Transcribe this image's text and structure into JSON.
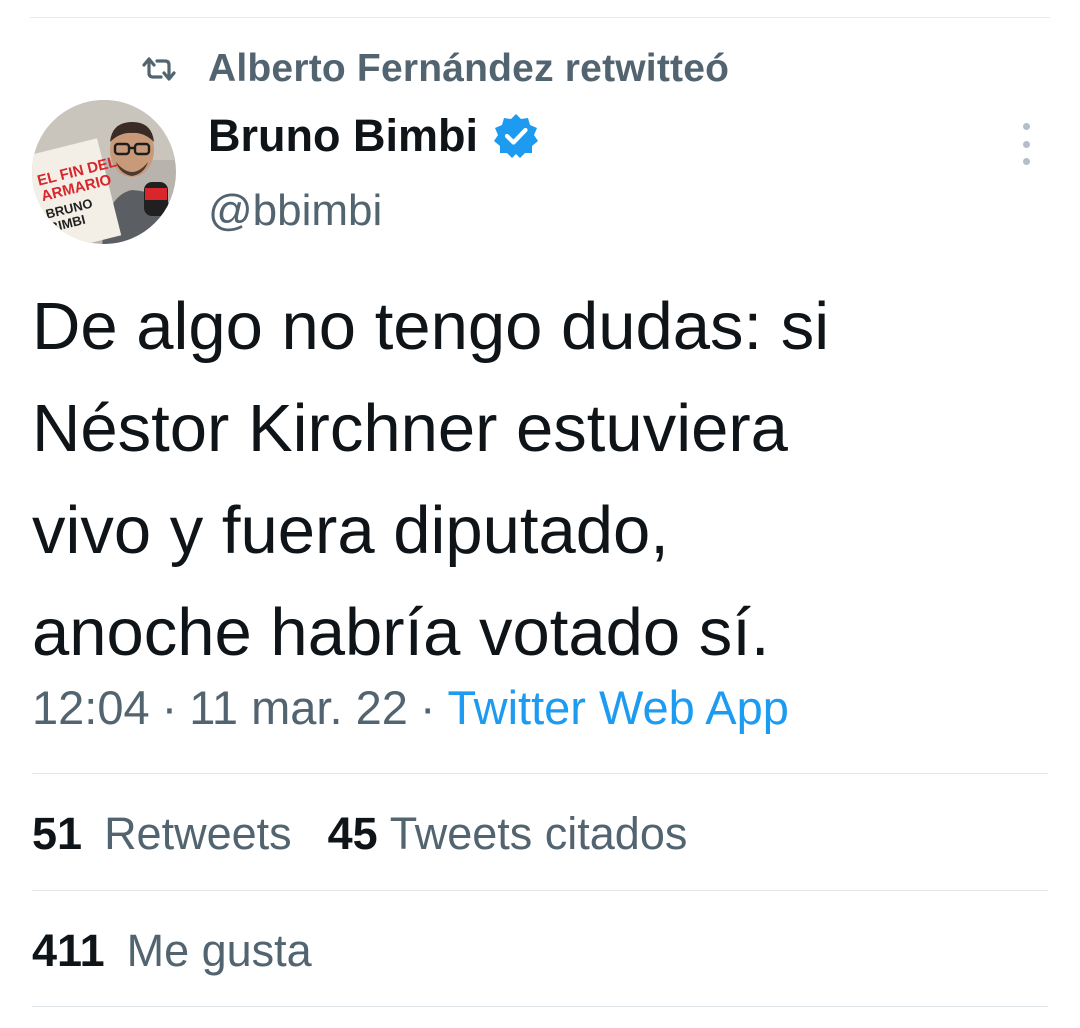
{
  "retweet": {
    "text": "Alberto Fernández retwitteó",
    "icon": "retweet-icon"
  },
  "author": {
    "display_name": "Bruno Bimbi",
    "handle": "@bbimbi",
    "verified": true,
    "verified_icon": "verified-badge-icon",
    "avatar_book_lines": [
      "EL FIN DEL",
      "ARMARIO",
      "BRUNO",
      "BIMBI"
    ]
  },
  "tweet": {
    "lines": [
      "De algo no tengo dudas: si",
      "Néstor Kirchner estuviera",
      "vivo y fuera diputado,",
      "anoche habría votado sí."
    ]
  },
  "meta": {
    "time": "12:04",
    "date": "11 mar. 22",
    "separator": "·",
    "source": "Twitter Web App"
  },
  "stats": {
    "retweets_count": "51",
    "retweets_label": "Retweets",
    "quotes_count": "45",
    "quotes_label": "Tweets citados",
    "likes_count": "411",
    "likes_label": "Me gusta"
  },
  "colors": {
    "text": "#0f1419",
    "secondary": "#536471",
    "accent": "#1d9bf0",
    "divider": "#dfe5e9"
  }
}
